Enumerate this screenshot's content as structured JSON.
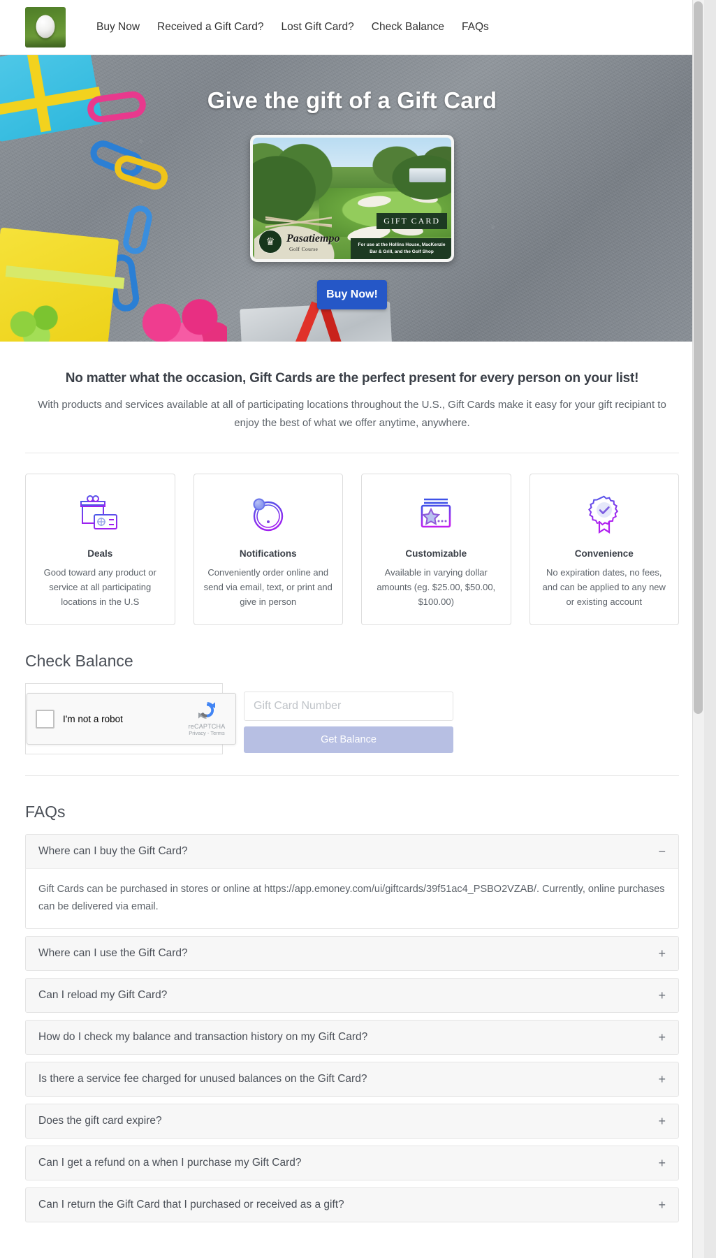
{
  "nav": {
    "logo_alt": "golf-ball-logo",
    "links": [
      {
        "label": "Buy Now"
      },
      {
        "label": "Received a Gift Card?"
      },
      {
        "label": "Lost Gift Card?"
      },
      {
        "label": "Check Balance"
      },
      {
        "label": "FAQs"
      }
    ]
  },
  "hero": {
    "title": "Give the gift of a Gift Card",
    "buy_button": "Buy Now!",
    "card": {
      "brand_name": "Pasatiempo",
      "brand_sub": "Golf Course",
      "label": "GIFT CARD",
      "footer": "For use at the Hollins House,\nMacKenzie Bar & Grill, and the Golf Shop"
    }
  },
  "intro": {
    "heading": "No matter what the occasion, Gift Cards are the perfect present for every person on your list!",
    "paragraph": "With products and services available at all of participating locations throughout the U.S., Gift Cards make it easy for your gift recipiant to enjoy the best of what we offer anytime, anywhere."
  },
  "features": [
    {
      "icon": "gift-box-card-icon",
      "title": "Deals",
      "desc": "Good toward any product or service at all participating locations in the U.S"
    },
    {
      "icon": "notification-alert-icon",
      "title": "Notifications",
      "desc": "Conveniently order online and send via email, text, or print and give in person"
    },
    {
      "icon": "star-card-icon",
      "title": "Customizable",
      "desc": "Available in varying dollar amounts (eg. $25.00, $50.00, $100.00)"
    },
    {
      "icon": "badge-check-icon",
      "title": "Convenience",
      "desc": "No expiration dates, no fees, and can be applied to any new or existing account"
    }
  ],
  "check_balance": {
    "title": "Check Balance",
    "recaptcha": {
      "label": "I'm not a robot",
      "brand": "reCAPTCHA",
      "terms": "Privacy - Terms"
    },
    "input_placeholder": "Gift Card Number",
    "input_value": "",
    "submit_label": "Get Balance"
  },
  "faqs": {
    "title": "FAQs",
    "items": [
      {
        "question": "Where can I buy the Gift Card?",
        "sign": "−",
        "open": true,
        "answer": "Gift Cards can be purchased in stores or online at https://app.emoney.com/ui/giftcards/39f51ac4_PSBO2VZAB/. Currently, online purchases can be delivered via email."
      },
      {
        "question": "Where can I use the Gift Card?",
        "sign": "+",
        "open": false,
        "answer": ""
      },
      {
        "question": "Can I reload my Gift Card?",
        "sign": "+",
        "open": false,
        "answer": ""
      },
      {
        "question": "How do I check my balance and transaction history on my Gift Card?",
        "sign": "+",
        "open": false,
        "answer": ""
      },
      {
        "question": "Is there a service fee charged for unused balances on the Gift Card?",
        "sign": "+",
        "open": false,
        "answer": ""
      },
      {
        "question": "Does the gift card expire?",
        "sign": "+",
        "open": false,
        "answer": ""
      },
      {
        "question": "Can I get a refund on a when I purchase my Gift Card?",
        "sign": "+",
        "open": false,
        "answer": ""
      },
      {
        "question": "Can I return the Gift Card that I purchased or received as a gift?",
        "sign": "+",
        "open": false,
        "answer": ""
      }
    ]
  },
  "colors": {
    "accent_blue": "#2557c7",
    "button_muted": "#b7bfe3",
    "icon_purple": "#a020f0",
    "icon_blue": "#4a5ae8"
  }
}
